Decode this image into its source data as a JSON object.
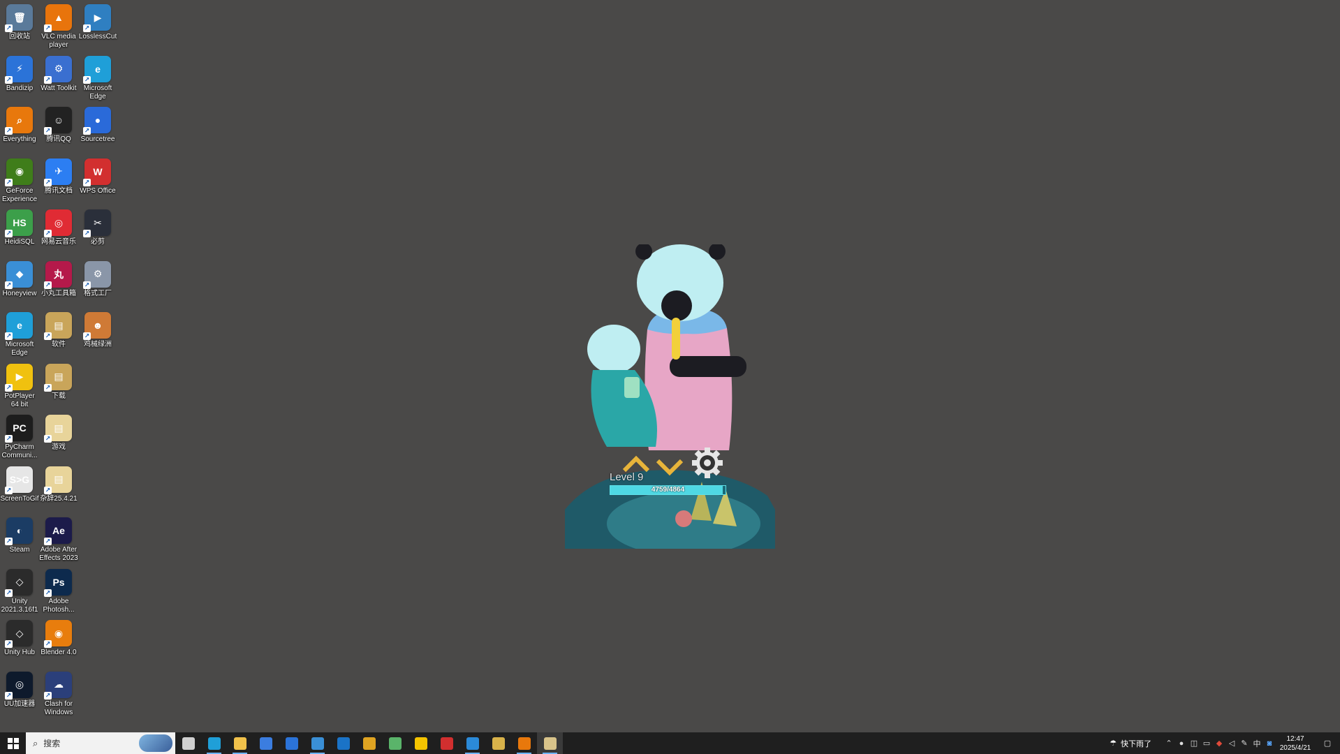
{
  "desktop_icons": [
    {
      "label": "回收站",
      "color": "#5a7a9a",
      "glyph": "🗑",
      "col": 0,
      "row": 0
    },
    {
      "label": "VLC media player",
      "color": "#e8740c",
      "glyph": "▲",
      "col": 1,
      "row": 0
    },
    {
      "label": "LosslessCut",
      "color": "#2f7fc1",
      "glyph": "▶",
      "col": 2,
      "row": 0
    },
    {
      "label": "Bandizip",
      "color": "#2b73d8",
      "glyph": "⚡",
      "col": 0,
      "row": 1
    },
    {
      "label": "Watt Toolkit",
      "color": "#3a6fd0",
      "glyph": "⚙",
      "col": 1,
      "row": 1
    },
    {
      "label": "Microsoft Edge",
      "color": "#1f9fd8",
      "glyph": "e",
      "col": 2,
      "row": 1
    },
    {
      "label": "Everything",
      "color": "#e8780c",
      "glyph": "⌕",
      "col": 0,
      "row": 2
    },
    {
      "label": "腾讯QQ",
      "color": "#222222",
      "glyph": "☺",
      "col": 1,
      "row": 2
    },
    {
      "label": "Sourcetree",
      "color": "#2a6ad9",
      "glyph": "●",
      "col": 2,
      "row": 2
    },
    {
      "label": "GeForce Experience",
      "color": "#3f7d1a",
      "glyph": "◉",
      "col": 0,
      "row": 3
    },
    {
      "label": "腾讯文档",
      "color": "#2c7ef2",
      "glyph": "✈",
      "col": 1,
      "row": 3
    },
    {
      "label": "WPS Office",
      "color": "#d22f2f",
      "glyph": "W",
      "col": 2,
      "row": 3
    },
    {
      "label": "HeidiSQL",
      "color": "#3c9f4a",
      "glyph": "HS",
      "col": 0,
      "row": 4
    },
    {
      "label": "网易云音乐",
      "color": "#e02b34",
      "glyph": "◎",
      "col": 1,
      "row": 4
    },
    {
      "label": "必剪",
      "color": "#2a2f3a",
      "glyph": "✂",
      "col": 2,
      "row": 4
    },
    {
      "label": "Honeyview",
      "color": "#3a8fd6",
      "glyph": "◆",
      "col": 0,
      "row": 5
    },
    {
      "label": "小丸工具箱",
      "color": "#b5194a",
      "glyph": "丸",
      "col": 1,
      "row": 5
    },
    {
      "label": "格式工厂",
      "color": "#8a96a8",
      "glyph": "⚙",
      "col": 2,
      "row": 5
    },
    {
      "label": "Microsoft Edge",
      "color": "#1f9fd8",
      "glyph": "e",
      "col": 0,
      "row": 6
    },
    {
      "label": "软件",
      "color": "#c9a55a",
      "glyph": "▤",
      "col": 1,
      "row": 6
    },
    {
      "label": "鸡械绿洲",
      "color": "#cf7a36",
      "glyph": "☻",
      "col": 2,
      "row": 6
    },
    {
      "label": "PotPlayer 64 bit",
      "color": "#f0c10f",
      "glyph": "▶",
      "col": 0,
      "row": 7
    },
    {
      "label": "下载",
      "color": "#c9a55a",
      "glyph": "▤",
      "col": 1,
      "row": 7
    },
    {
      "label": "PyCharm Communi...",
      "color": "#1d1d1d",
      "glyph": "PC",
      "col": 0,
      "row": 8
    },
    {
      "label": "游戏",
      "color": "#e8d49a",
      "glyph": "▤",
      "col": 1,
      "row": 8
    },
    {
      "label": "ScreenToGif",
      "color": "#e6e6e6",
      "glyph": "S>G",
      "col": 0,
      "row": 9
    },
    {
      "label": "杂辞25.4.21",
      "color": "#e8d49a",
      "glyph": "▤",
      "col": 1,
      "row": 9
    },
    {
      "label": "Steam",
      "color": "#1b3c64",
      "glyph": "◐",
      "col": 0,
      "row": 10
    },
    {
      "label": "Adobe After Effects 2023",
      "color": "#1c1b4a",
      "glyph": "Ae",
      "col": 1,
      "row": 10
    },
    {
      "label": "Unity 2021.3.16f1",
      "color": "#2b2b2b",
      "glyph": "◇",
      "col": 0,
      "row": 11
    },
    {
      "label": "Adobe Photosh...",
      "color": "#0d2a4d",
      "glyph": "Ps",
      "col": 1,
      "row": 11
    },
    {
      "label": "Unity Hub",
      "color": "#2b2b2b",
      "glyph": "◇",
      "col": 0,
      "row": 12
    },
    {
      "label": "Blender 4.0",
      "color": "#e87d0d",
      "glyph": "◉",
      "col": 1,
      "row": 12
    },
    {
      "label": "UU加速器",
      "color": "#0e1a2c",
      "glyph": "◎",
      "col": 0,
      "row": 13
    },
    {
      "label": "Clash for Windows",
      "color": "#2b3f7a",
      "glyph": "☁",
      "col": 1,
      "row": 13
    }
  ],
  "pet_widget": {
    "level_label": "Level 9",
    "progress_text": "4759/4864",
    "progress_fraction": 0.978
  },
  "taskbar": {
    "search_placeholder": "搜索",
    "apps": [
      {
        "name": "task-view",
        "color": "#d0d0d0",
        "running": false
      },
      {
        "name": "edge",
        "color": "#1f9fd8",
        "running": true
      },
      {
        "name": "file-explorer",
        "color": "#f0c14b",
        "running": true
      },
      {
        "name": "microsoft-store",
        "color": "#3b7de0",
        "running": false
      },
      {
        "name": "bandizip",
        "color": "#2b73d8",
        "running": false
      },
      {
        "name": "steam",
        "color": "#3a8fd6",
        "running": true
      },
      {
        "name": "outlook",
        "color": "#1a73c7",
        "running": false
      },
      {
        "name": "chrome",
        "color": "#e0a422",
        "running": false
      },
      {
        "name": "image-viewer",
        "color": "#5ab46a",
        "running": false
      },
      {
        "name": "sticky-notes",
        "color": "#f5c400",
        "running": false
      },
      {
        "name": "wps",
        "color": "#d22f2f",
        "running": false
      },
      {
        "name": "app-blue",
        "color": "#2b8ad8",
        "running": true
      },
      {
        "name": "app-coin",
        "color": "#d8b24a",
        "running": false
      },
      {
        "name": "everything",
        "color": "#e8780c",
        "running": true
      },
      {
        "name": "pet-app",
        "color": "#d8c38a",
        "running": true
      }
    ],
    "weather": "快下雨了",
    "ime": "中",
    "time": "12:47",
    "date": "2025/4/21"
  }
}
